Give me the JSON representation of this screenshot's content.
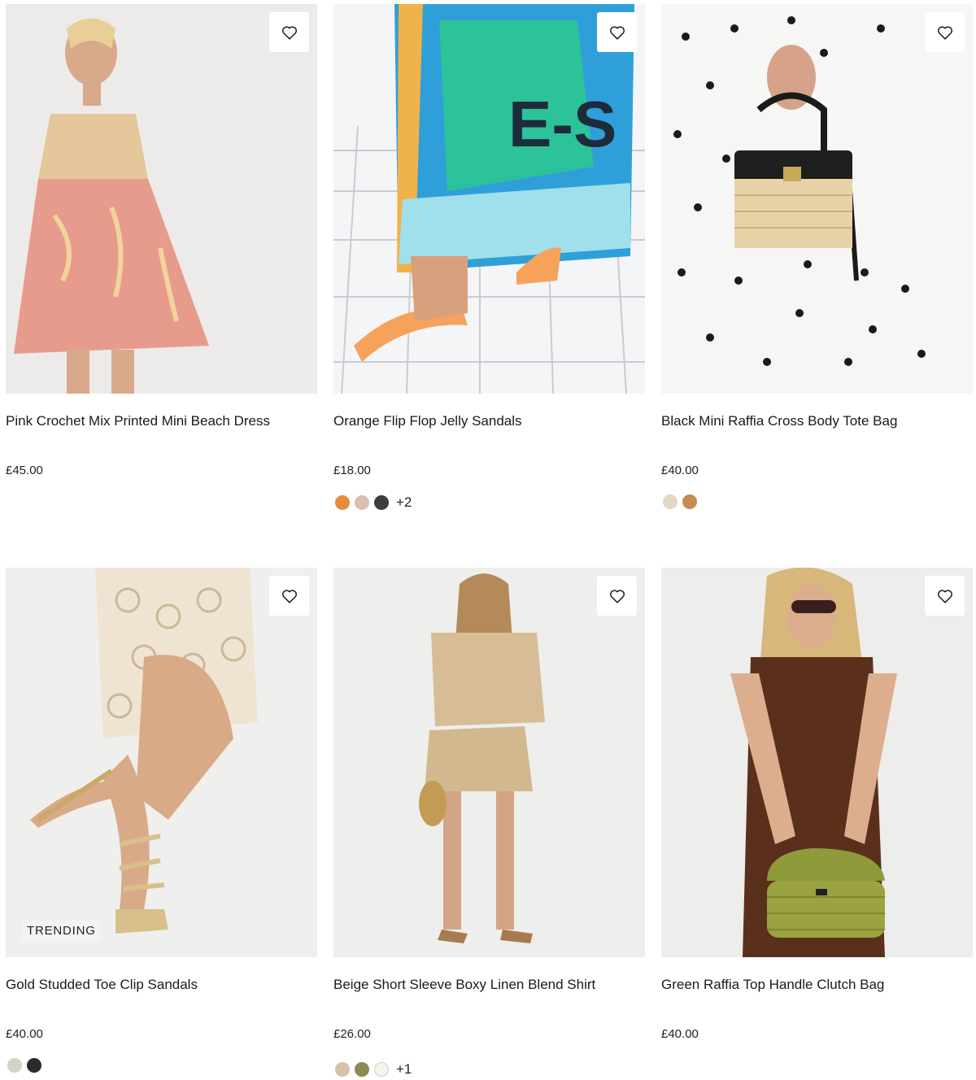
{
  "products": [
    {
      "name": "Pink Crochet Mix Printed Mini Beach Dress",
      "price": "£45.00",
      "badge": "",
      "image_bg": "#ecebe9",
      "swatches": [],
      "more": ""
    },
    {
      "name": "Orange Flip Flop Jelly Sandals",
      "price": "£18.00",
      "badge": "",
      "image_bg": "#f4f5f6",
      "swatches": [
        "#e78a3c",
        "#d9bfae",
        "#3d3d3d"
      ],
      "more": "+2"
    },
    {
      "name": "Black Mini Raffia Cross Body Tote Bag",
      "price": "£40.00",
      "badge": "",
      "image_bg": "#f6f6f4",
      "swatches": [
        "#e2d7c5",
        "#c98a52"
      ],
      "more": ""
    },
    {
      "name": "Gold Studded Toe Clip Sandals",
      "price": "£40.00",
      "badge": "TRENDING",
      "image_bg": "#efefed",
      "swatches": [
        "#d2d2c6",
        "#2b2b2b"
      ],
      "more": ""
    },
    {
      "name": "Beige Short Sleeve Boxy Linen Blend Shirt",
      "price": "£26.00",
      "badge": "",
      "image_bg": "#eeeeec",
      "swatches": [
        "#d6c2a7",
        "#8c8a52",
        "#f3f3f0"
      ],
      "more": "+1"
    },
    {
      "name": "Green Raffia Top Handle Clutch Bag",
      "price": "£40.00",
      "badge": "",
      "image_bg": "#ededeb",
      "swatches": [],
      "more": ""
    }
  ],
  "icons": {
    "wishlist": "heart-outline-icon"
  },
  "colors": {
    "text": "#1a1a1a",
    "badge_bg": "#f3f3f1"
  }
}
